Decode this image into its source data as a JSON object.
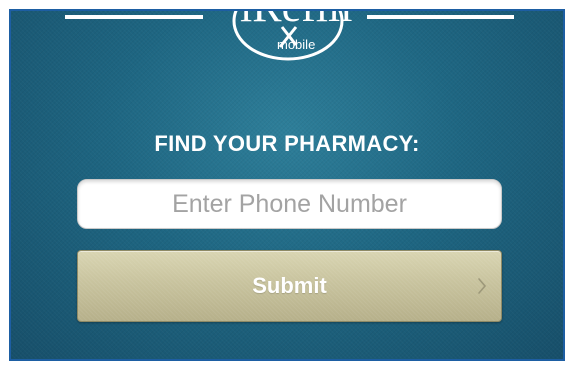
{
  "logo": {
    "name": "iRefill",
    "sub": "mobile",
    "icon": "rx-logo-icon"
  },
  "heading": "FIND YOUR PHARMACY:",
  "phone": {
    "value": "",
    "placeholder": "Enter Phone Number"
  },
  "submit": {
    "label": "Submit",
    "icon": "chevron-right-icon"
  },
  "colors": {
    "background": "#1e6682",
    "button": "#c8c39e",
    "frame_border": "#1d5ea3",
    "text": "#ffffff"
  }
}
